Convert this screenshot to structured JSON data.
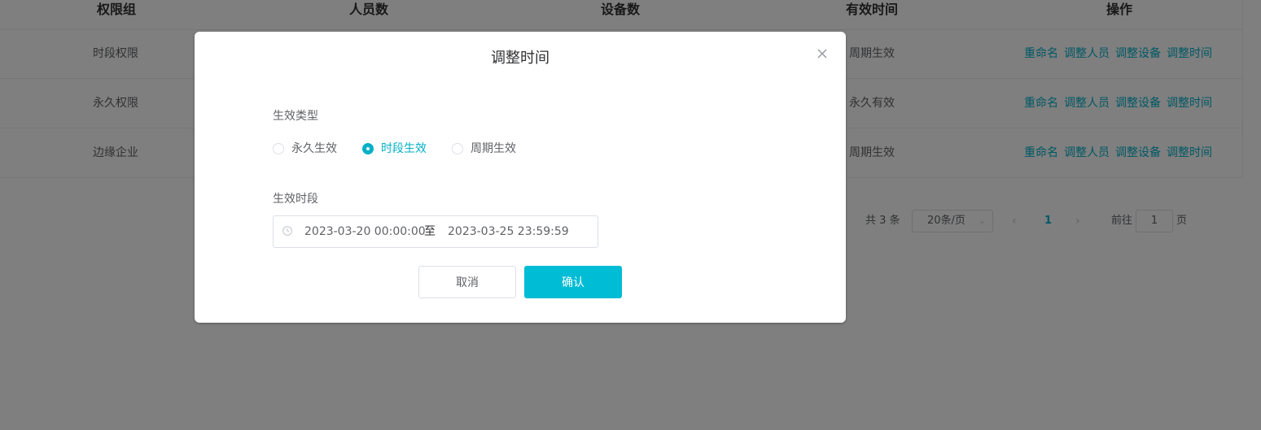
{
  "table": {
    "headers": [
      "权限组",
      "人员数",
      "设备数",
      "有效时间",
      "操作"
    ],
    "rows": [
      {
        "name": "时段权限",
        "validity": "周期生效"
      },
      {
        "name": "永久权限",
        "validity": "永久有效"
      },
      {
        "name": "边缘企业",
        "validity": "周期生效"
      }
    ],
    "actions": [
      "重命名",
      "调整人员",
      "调整设备",
      "调整时间"
    ]
  },
  "pagination": {
    "total": "共 3 条",
    "page_size": "20条/页",
    "current_page": "1",
    "goto_label": "前往",
    "goto_value": "1",
    "page_suffix": "页"
  },
  "dialog": {
    "title": "调整时间",
    "type_label": "生效类型",
    "types": [
      "永久生效",
      "时段生效",
      "周期生效"
    ],
    "selected_type": "时段生效",
    "range_label": "生效时段",
    "range_start": "2023-03-20 00:00:00",
    "range_separator": "至",
    "range_end": "2023-03-25 23:59:59",
    "cancel_label": "取消",
    "confirm_label": "确认"
  },
  "colors": {
    "accent": "#00b0c8",
    "primary_button": "#00bcd4",
    "overlay": "rgba(0,0,0,0.5)"
  }
}
